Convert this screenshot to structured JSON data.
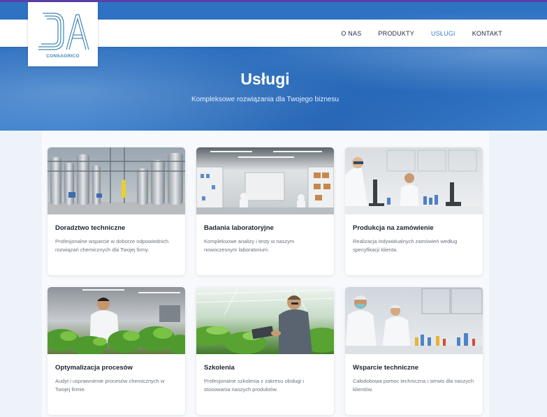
{
  "brand": {
    "name": "CONSAGRICO",
    "accent": "#3f7fd6",
    "topline": "#5b3fa8"
  },
  "nav": {
    "items": [
      {
        "label": "O NAS",
        "active": false
      },
      {
        "label": "PRODUKTY",
        "active": false
      },
      {
        "label": "USŁUGI",
        "active": true
      },
      {
        "label": "KONTAKT",
        "active": false
      }
    ]
  },
  "hero": {
    "title": "Usługi",
    "subtitle": "Kompleksowe rozwiązania dla Twojego biznesu"
  },
  "services": [
    {
      "title": "Doradztwo techniczne",
      "description": "Profesjonalne wsparcie w doborze odpowiednich rozwiązań chemicznych dla Twojej firmy.",
      "image": "industrial-plant-photo"
    },
    {
      "title": "Badania laboratoryjne",
      "description": "Kompleksowe analizy i testy w naszym nowoczesnym laboratorium.",
      "image": "laboratory-photo"
    },
    {
      "title": "Produkcja na zamówienie",
      "description": "Realizacja indywidualnych zamówień według specyfikacji klienta.",
      "image": "microscope-lab-photo"
    },
    {
      "title": "Optymalizacja procesów",
      "description": "Audyt i usprawnienie procesów chemicznych w Twojej firmie.",
      "image": "plant-research-photo"
    },
    {
      "title": "Szkolenia",
      "description": "Profesjonalne szkolenia z zakresu obsługi i stosowania naszych produktów.",
      "image": "greenhouse-tablet-photo"
    },
    {
      "title": "Wsparcie techniczne",
      "description": "Całodobowa pomoc techniczna i serwis dla naszych klientów.",
      "image": "lab-scientists-photo"
    }
  ]
}
